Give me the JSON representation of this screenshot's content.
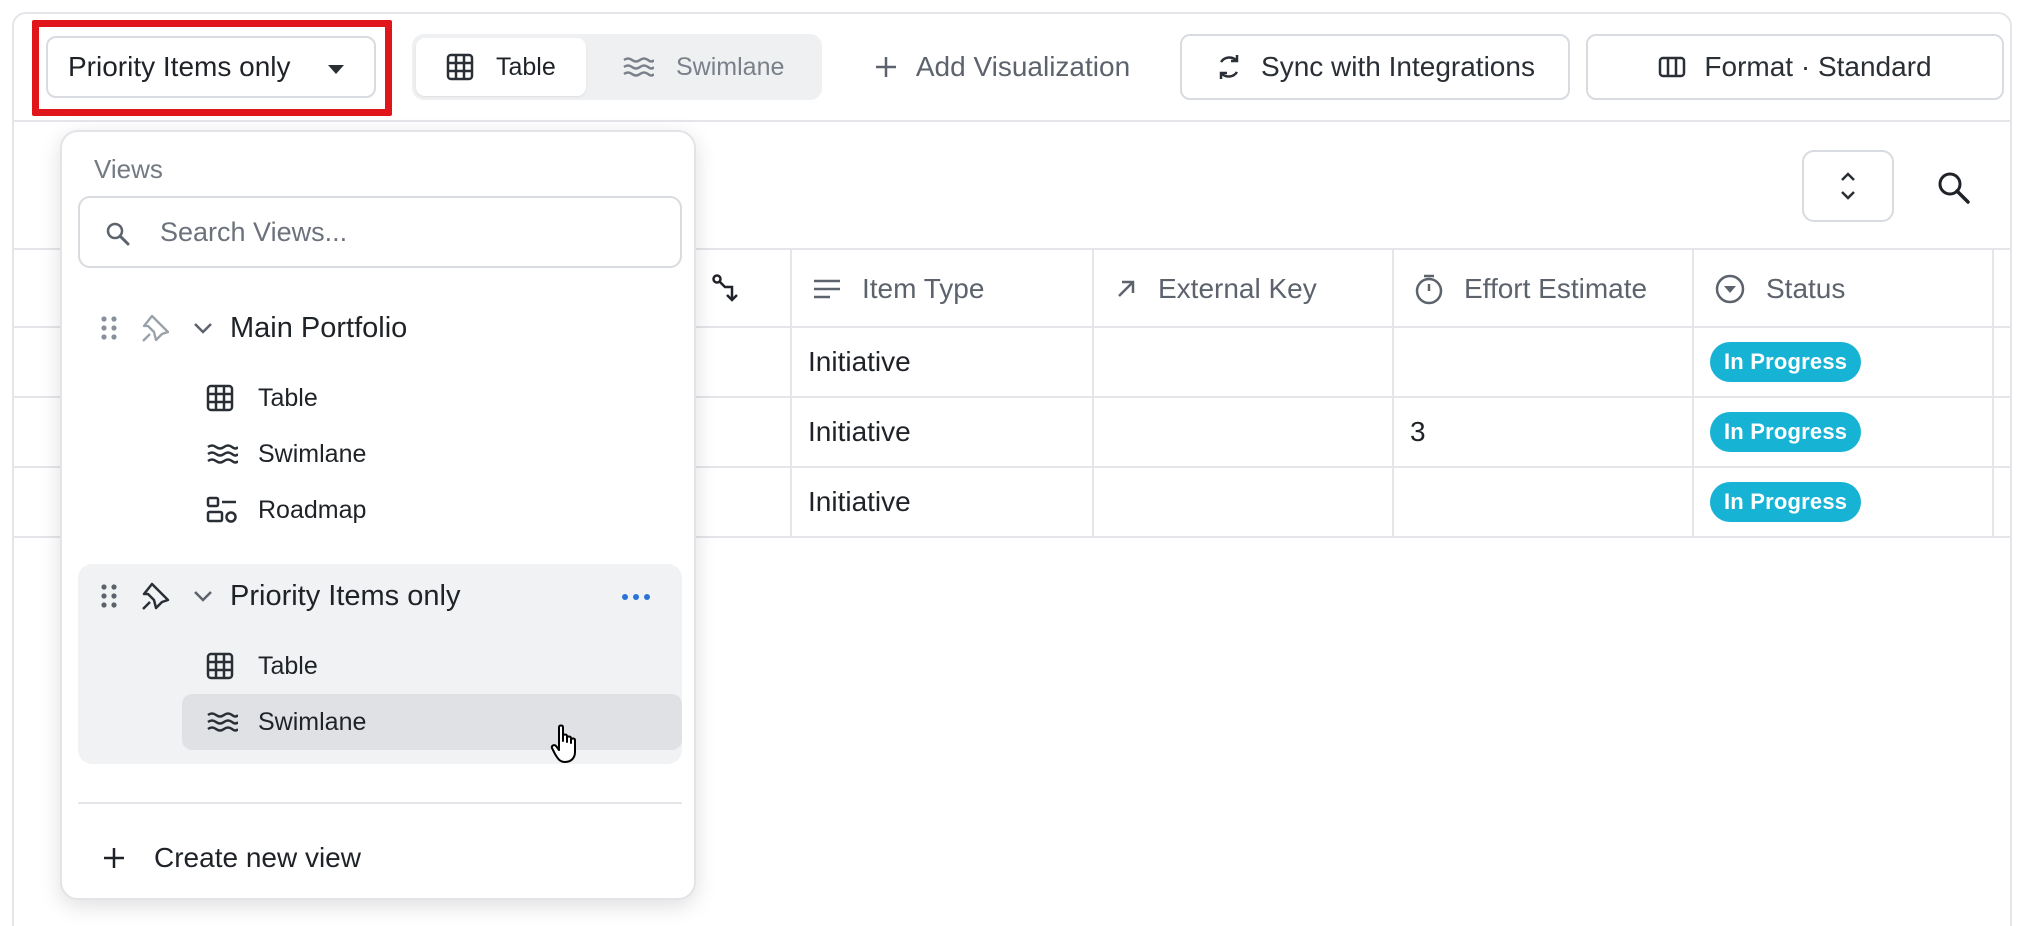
{
  "toolbar": {
    "view_selector_label": "Priority Items only",
    "tabs": [
      {
        "label": "Table",
        "icon": "grid-icon",
        "active": true
      },
      {
        "label": "Swimlane",
        "icon": "swimlane-icon",
        "active": false
      }
    ],
    "add_visualization_label": "Add Visualization",
    "sync_label": "Sync with Integrations",
    "format_label": "Format · Standard"
  },
  "table": {
    "columns": [
      {
        "label": "",
        "icon": "branch-icon"
      },
      {
        "label": "Item Type",
        "icon": "lines-icon"
      },
      {
        "label": "External Key",
        "icon": "arrow-up-right-icon"
      },
      {
        "label": "Effort Estimate",
        "icon": "stopwatch-icon"
      },
      {
        "label": "Status",
        "icon": "circle-caret-icon"
      }
    ],
    "rows": [
      {
        "item_type": "Initiative",
        "external_key": "",
        "effort_estimate": "",
        "status": "In Progress"
      },
      {
        "item_type": "Initiative",
        "external_key": "",
        "effort_estimate": "3",
        "status": "In Progress"
      },
      {
        "item_type": "Initiative",
        "external_key": "",
        "effort_estimate": "",
        "status": "In Progress"
      }
    ]
  },
  "dropdown": {
    "heading": "Views",
    "search_placeholder": "Search Views...",
    "groups": [
      {
        "name": "Main Portfolio",
        "items": [
          {
            "label": "Table",
            "icon": "grid-icon"
          },
          {
            "label": "Swimlane",
            "icon": "swimlane-icon"
          },
          {
            "label": "Roadmap",
            "icon": "roadmap-icon"
          }
        ]
      },
      {
        "name": "Priority Items only",
        "items": [
          {
            "label": "Table",
            "icon": "grid-icon"
          },
          {
            "label": "Swimlane",
            "icon": "swimlane-icon"
          }
        ]
      }
    ],
    "create_label": "Create new view"
  },
  "colors": {
    "highlight": "#e0161b",
    "status_badge": "#17b3d5",
    "more_dots": "#2a73d9"
  }
}
